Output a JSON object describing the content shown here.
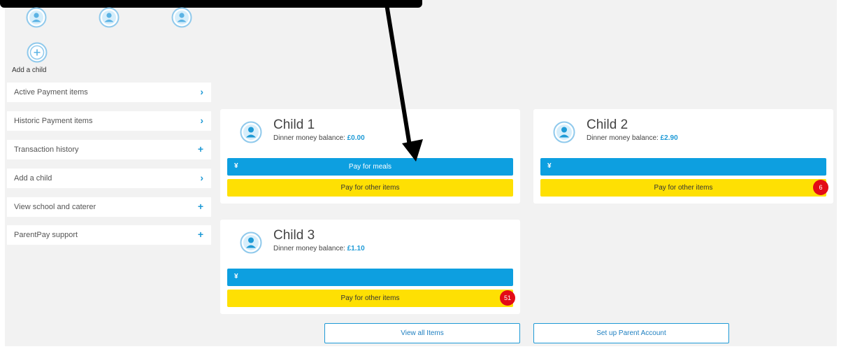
{
  "add_child": {
    "label": "Add a child"
  },
  "menu": {
    "items": [
      {
        "label": "Active Payment items",
        "icon": "chevron-right-icon",
        "glyph": "›"
      },
      {
        "label": "Historic Payment items",
        "icon": "chevron-right-icon",
        "glyph": "›"
      },
      {
        "label": "Transaction history",
        "icon": "plus-icon",
        "glyph": "+"
      },
      {
        "label": "Add a child",
        "icon": "chevron-right-icon",
        "glyph": "›"
      },
      {
        "label": "View school and caterer",
        "icon": "plus-icon",
        "glyph": "+"
      },
      {
        "label": "ParentPay support",
        "icon": "plus-icon",
        "glyph": "+"
      }
    ]
  },
  "children": [
    {
      "name": "Child 1",
      "balance_label": "Dinner money balance:",
      "balance": "£0.00",
      "meals_label": "Pay for meals",
      "other_label": "Pay for other items",
      "badge": ""
    },
    {
      "name": "Child 2",
      "balance_label": "Dinner money balance:",
      "balance": "£2.90",
      "meals_label": "",
      "other_label": "Pay for other items",
      "badge": "6"
    },
    {
      "name": "Child 3",
      "balance_label": "Dinner money balance:",
      "balance": "£1.10",
      "meals_label": "",
      "other_label": "Pay for other items",
      "badge": "51"
    }
  ],
  "buttons": {
    "view_all": "View all Items",
    "setup_parent": "Set up Parent Account"
  },
  "colors": {
    "accent_blue": "#0d9fe0",
    "yellow": "#fee003",
    "badge_red": "#e30b16"
  }
}
